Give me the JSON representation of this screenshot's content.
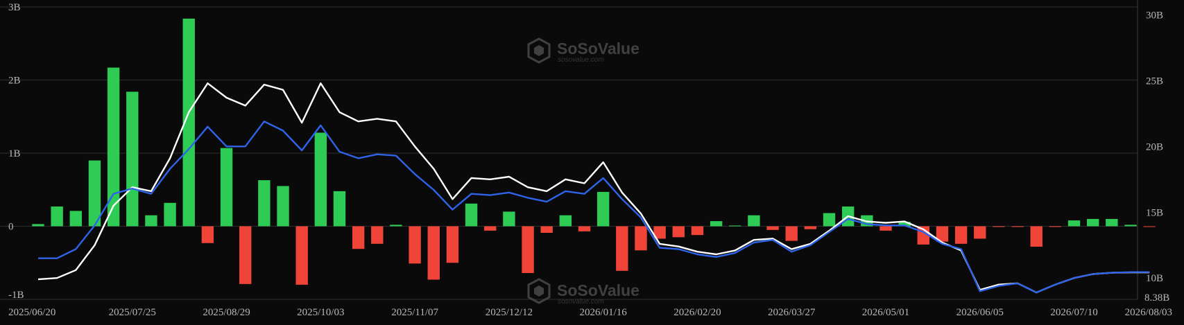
{
  "chart_data": {
    "type": "bar",
    "watermark": {
      "name": "SoSoValue",
      "url": "sosovalue.com"
    },
    "x_tick_labels": [
      "2025/06/20",
      "2025/07/25",
      "2025/08/29",
      "2025/10/03",
      "2025/11/07",
      "2025/12/12",
      "2026/01/16",
      "2026/02/20",
      "2026/03/27",
      "2026/05/01",
      "2026/06/05",
      "2026/07/10",
      "2026/08/03"
    ],
    "left_axis": {
      "ticks": [
        3,
        2,
        1,
        0,
        -1
      ],
      "tick_labels": [
        "3B",
        "2B",
        "1B",
        "0",
        "-1B"
      ],
      "ylim": [
        -1,
        3
      ]
    },
    "right_axis": {
      "ticks": [
        30,
        25,
        20,
        15,
        10
      ],
      "tick_labels": [
        "30B",
        "25B",
        "20B",
        "15B",
        "10B"
      ],
      "min_label": "8.38B",
      "ylim": [
        8.38,
        30.6
      ]
    },
    "colors": {
      "positive": "#2ecc54",
      "negative": "#f04438",
      "line_a": "#ffffff",
      "line_b": "#2f63e8",
      "grid": "#2e2e2e"
    },
    "x": [
      "2025/06/20",
      "2025/06/27",
      "2025/07/04",
      "2025/07/11",
      "2025/07/18",
      "2025/07/25",
      "2025/08/01",
      "2025/08/08",
      "2025/08/15",
      "2025/08/22",
      "2025/08/29",
      "2025/09/05",
      "2025/09/12",
      "2025/09/19",
      "2025/09/26",
      "2025/10/03",
      "2025/10/10",
      "2025/10/17",
      "2025/10/24",
      "2025/10/31",
      "2025/11/07",
      "2025/11/14",
      "2025/11/21",
      "2025/11/28",
      "2025/12/05",
      "2025/12/12",
      "2025/12/19",
      "2025/12/26",
      "2026/01/02",
      "2026/01/09",
      "2026/01/16",
      "2026/01/23",
      "2026/01/30",
      "2026/02/06",
      "2026/02/13",
      "2026/02/20",
      "2026/02/27",
      "2026/03/06",
      "2026/03/13",
      "2026/03/20",
      "2026/03/27",
      "2026/04/03",
      "2026/04/10",
      "2026/04/17",
      "2026/04/24",
      "2026/05/01",
      "2026/05/08",
      "2026/05/15",
      "2026/05/22",
      "2026/05/29",
      "2026/06/05",
      "2026/06/12",
      "2026/06/19",
      "2026/06/26",
      "2026/07/03",
      "2026/07/10",
      "2026/07/17",
      "2026/07/24",
      "2026/08/03"
    ],
    "series": [
      {
        "type": "bar",
        "axis": "left",
        "values": [
          0.03,
          0.27,
          0.21,
          0.9,
          2.17,
          1.84,
          0.15,
          0.32,
          2.84,
          -0.23,
          1.07,
          -0.79,
          0.63,
          0.55,
          -0.8,
          1.28,
          0.48,
          -0.31,
          -0.24,
          0.02,
          -0.51,
          -0.73,
          -0.5,
          0.31,
          -0.06,
          0.2,
          -0.64,
          -0.09,
          0.15,
          -0.07,
          0.47,
          -0.61,
          -0.33,
          -0.17,
          -0.15,
          -0.12,
          0.07,
          0.01,
          0.15,
          -0.05,
          -0.2,
          -0.04,
          0.18,
          0.27,
          0.15,
          -0.06,
          0.06,
          -0.25,
          -0.21,
          -0.24,
          -0.17,
          -0.01,
          -0.01,
          -0.28,
          -0.01,
          0.08,
          0.1,
          0.1,
          0.02,
          -0.01
        ]
      },
      {
        "type": "line",
        "axis": "right",
        "color": "#ffffff",
        "values": [
          9.9,
          10.0,
          10.6,
          12.5,
          15.5,
          16.9,
          16.6,
          19.1,
          22.6,
          24.8,
          23.7,
          23.1,
          24.7,
          24.3,
          21.8,
          24.8,
          22.6,
          21.9,
          22.1,
          21.9,
          20.0,
          18.3,
          16.0,
          17.6,
          17.5,
          17.7,
          16.9,
          16.6,
          17.5,
          17.2,
          18.8,
          16.5,
          14.9,
          12.6,
          12.4,
          12.0,
          11.8,
          12.1,
          12.9,
          13.0,
          12.2,
          12.6,
          13.6,
          14.7,
          14.3,
          14.2,
          14.3,
          13.7,
          12.7,
          12.1,
          9.1,
          9.5,
          9.6,
          8.9,
          9.5,
          10.0,
          10.3,
          10.4,
          10.43,
          10.43
        ]
      },
      {
        "type": "line",
        "axis": "right",
        "color": "#2f63e8",
        "values": [
          11.5,
          11.5,
          12.2,
          14.0,
          16.4,
          16.8,
          16.4,
          18.3,
          19.8,
          21.5,
          20.0,
          20.0,
          21.9,
          21.2,
          19.7,
          21.6,
          19.6,
          19.1,
          19.4,
          19.3,
          17.9,
          16.7,
          15.2,
          16.4,
          16.3,
          16.5,
          16.1,
          15.8,
          16.6,
          16.4,
          17.6,
          16.0,
          14.6,
          12.3,
          12.2,
          11.8,
          11.6,
          11.9,
          12.7,
          12.9,
          12.0,
          12.5,
          13.5,
          14.5,
          14.1,
          14.0,
          14.0,
          13.5,
          12.6,
          12.2,
          9.0,
          9.4,
          9.6,
          8.9,
          9.5,
          10.0,
          10.3,
          10.4,
          10.45,
          10.45
        ]
      }
    ]
  }
}
